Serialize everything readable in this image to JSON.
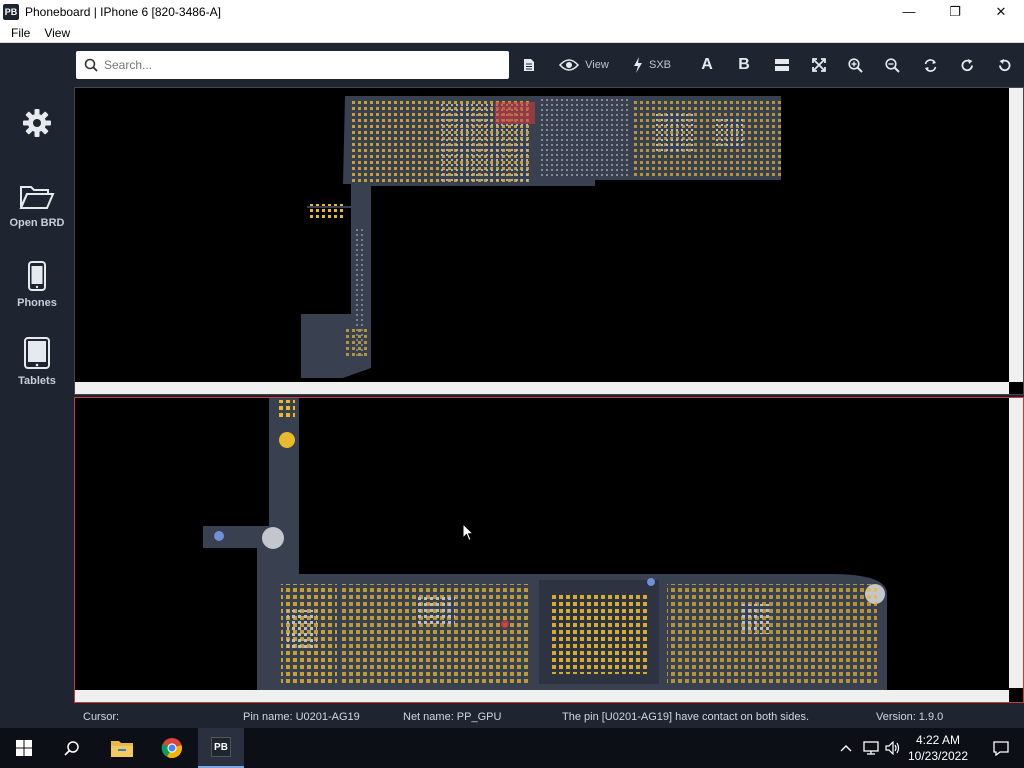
{
  "window": {
    "app_icon": "PB",
    "title": "Phoneboard | IPhone 6 [820-3486-A]",
    "controls": [
      "minimize-icon",
      "maximize-icon",
      "close-icon"
    ]
  },
  "menu": {
    "items": [
      "File",
      "View"
    ]
  },
  "sidebar": {
    "items": [
      {
        "icon": "gear-icon",
        "label": ""
      },
      {
        "icon": "folder-open-icon",
        "label": "Open BRD"
      },
      {
        "icon": "phone-icon",
        "label": "Phones"
      },
      {
        "icon": "tablet-icon",
        "label": "Tablets"
      }
    ]
  },
  "toolbar": {
    "search_placeholder": "Search...",
    "view_label": "View",
    "sxb_label": "SXB",
    "side_a": "A",
    "side_b": "B"
  },
  "status": {
    "cursor": "Cursor:",
    "pin_name": "Pin name: U0201-AG19",
    "net_name": "Net name: PP_GPU",
    "message": "The pin [U0201-AG19] have contact on both sides.",
    "version": "Version: 1.9.0"
  },
  "taskbar": {
    "apps": [
      "windows-start-icon",
      "search-icon",
      "file-explorer-icon",
      "chrome-icon",
      "phoneboard-icon"
    ],
    "phoneboard_label": "PB",
    "time": "4:22 AM",
    "date": "10/23/2022"
  },
  "colors": {
    "background": "#1e2430",
    "board": "#39404f",
    "pad_yellow": "#e8b92c",
    "selected_red": "#c93b3b",
    "pad_blue": "#6f8fd6"
  }
}
